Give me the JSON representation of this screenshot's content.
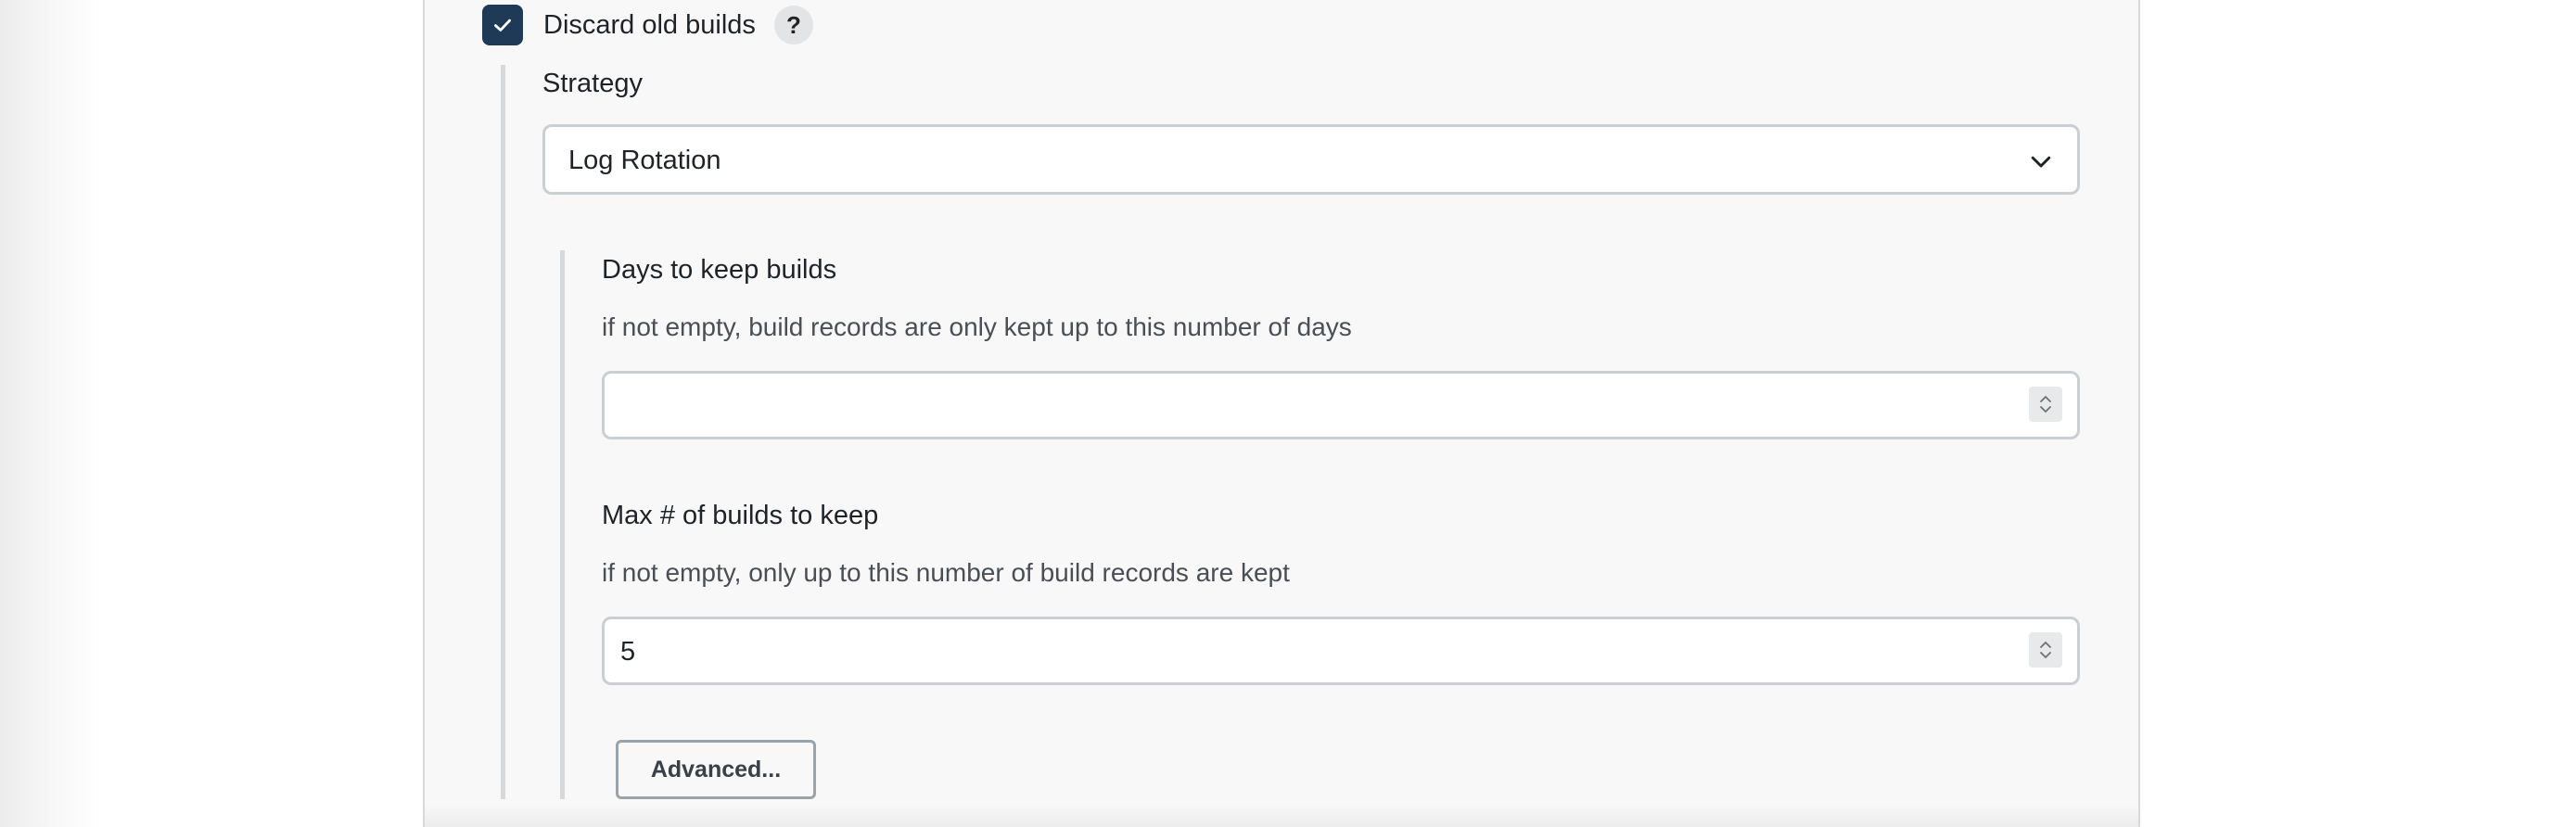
{
  "discard_old_builds": {
    "label": "Discard old builds",
    "checked": true,
    "help_label": "?"
  },
  "strategy": {
    "label": "Strategy",
    "selected": "Log Rotation"
  },
  "days_to_keep": {
    "label": "Days to keep builds",
    "description": "if not empty, build records are only kept up to this number of days",
    "value": ""
  },
  "max_builds": {
    "label": "Max # of builds to keep",
    "description": "if not empty, only up to this number of build records are kept",
    "value": "5"
  },
  "advanced_button": {
    "label": "Advanced..."
  },
  "colors": {
    "checkbox_fill": "#1e3a56",
    "panel_background": "#f8f8f8",
    "input_border": "#c9cfd3"
  }
}
